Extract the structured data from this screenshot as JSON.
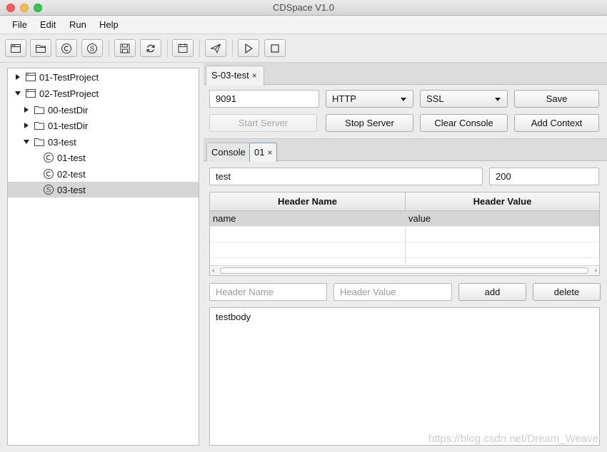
{
  "window": {
    "title": "CDSpace V1.0"
  },
  "menu": [
    "File",
    "Edit",
    "Run",
    "Help"
  ],
  "toolbar": {
    "icons": [
      "new-window-icon",
      "open-folder-icon",
      "copyright-c-icon",
      "s-circle-icon",
      "save-icon",
      "refresh-icon",
      "calendar-icon",
      "send-icon",
      "play-icon",
      "stop-icon"
    ]
  },
  "tree": {
    "items": [
      {
        "label": "01-TestProject",
        "level": 0,
        "expanded": false,
        "icon": "project-window-icon"
      },
      {
        "label": "02-TestProject",
        "level": 0,
        "expanded": true,
        "icon": "project-window-icon"
      },
      {
        "label": "00-testDir",
        "level": 1,
        "expanded": false,
        "icon": "folder-icon"
      },
      {
        "label": "01-testDir",
        "level": 1,
        "expanded": false,
        "icon": "folder-icon"
      },
      {
        "label": "03-test",
        "level": 1,
        "expanded": true,
        "icon": "folder-icon"
      },
      {
        "label": "01-test",
        "level": 2,
        "icon": "c-circle-icon"
      },
      {
        "label": "02-test",
        "level": 2,
        "icon": "c-circle-icon"
      },
      {
        "label": "03-test",
        "level": 2,
        "icon": "s-circle-icon",
        "selected": true
      }
    ]
  },
  "server_tab": {
    "label": "S-03-test",
    "close": "×"
  },
  "server": {
    "port": "9091",
    "protocol": "HTTP",
    "security": "SSL",
    "save_label": "Save",
    "start_label": "Start Server",
    "stop_label": "Stop Server",
    "clear_label": "Clear Console",
    "add_context_label": "Add Context"
  },
  "inner_tabs": [
    {
      "label": "Console"
    },
    {
      "label": "01",
      "close": "×",
      "active": true
    }
  ],
  "context": {
    "path": "test",
    "status": "200"
  },
  "headers_table": {
    "columns": [
      "Header Name",
      "Header Value"
    ],
    "rows": [
      {
        "name": "name",
        "value": "value"
      }
    ]
  },
  "header_form": {
    "name_placeholder": "Header Name",
    "value_placeholder": "Header Value",
    "add_label": "add",
    "delete_label": "delete"
  },
  "body": {
    "text": "testbody"
  },
  "watermark": "https://blog.csdn.net/Dream_Weave"
}
